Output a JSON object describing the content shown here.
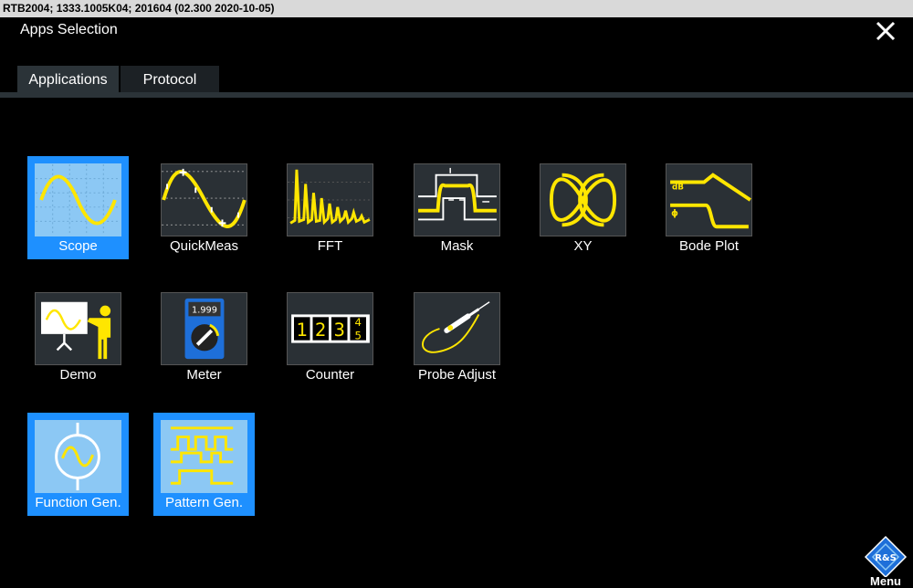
{
  "status_bar": {
    "text": "RTB2004; 1333.1005K04; 201604 (02.300 2020-10-05)"
  },
  "dialog": {
    "title": "Apps Selection"
  },
  "tabs": [
    {
      "label": "Applications",
      "active": true
    },
    {
      "label": "Protocol",
      "active": false
    }
  ],
  "apps": [
    {
      "label": "Scope",
      "icon": "sine-wave-icon",
      "selected": true
    },
    {
      "label": "QuickMeas",
      "icon": "quickmeas-icon",
      "selected": false
    },
    {
      "label": "FFT",
      "icon": "fft-spectrum-icon",
      "selected": false
    },
    {
      "label": "Mask",
      "icon": "mask-icon",
      "selected": false
    },
    {
      "label": "XY",
      "icon": "lissajous-icon",
      "selected": false
    },
    {
      "label": "Bode Plot",
      "icon": "bode-plot-icon",
      "selected": false
    },
    {
      "label": "Demo",
      "icon": "presenter-icon",
      "selected": false
    },
    {
      "label": "Meter",
      "icon": "multimeter-icon",
      "selected": false
    },
    {
      "label": "Counter",
      "icon": "counter-icon",
      "selected": false
    },
    {
      "label": "Probe Adjust",
      "icon": "probe-icon",
      "selected": false
    },
    {
      "label": "Function Gen.",
      "icon": "function-generator-icon",
      "selected": true
    },
    {
      "label": "Pattern Gen.",
      "icon": "pattern-generator-icon",
      "selected": true
    }
  ],
  "icon_text": {
    "bode_db": "dB",
    "bode_phase": "ϕ",
    "meter_reading": "1.999",
    "counter_digits": [
      "1",
      "2",
      "3"
    ],
    "counter_rolling_digits": [
      "4",
      "5"
    ]
  },
  "menu": {
    "label": "Menu",
    "logo_text": "R&S"
  },
  "colors": {
    "accent_yellow": "#ffe600",
    "selection_blue": "#1e90ff",
    "selected_icon_bg": "#8cc8f4",
    "tile_bg": "#2a3035",
    "tab_active": "#2b3338"
  }
}
